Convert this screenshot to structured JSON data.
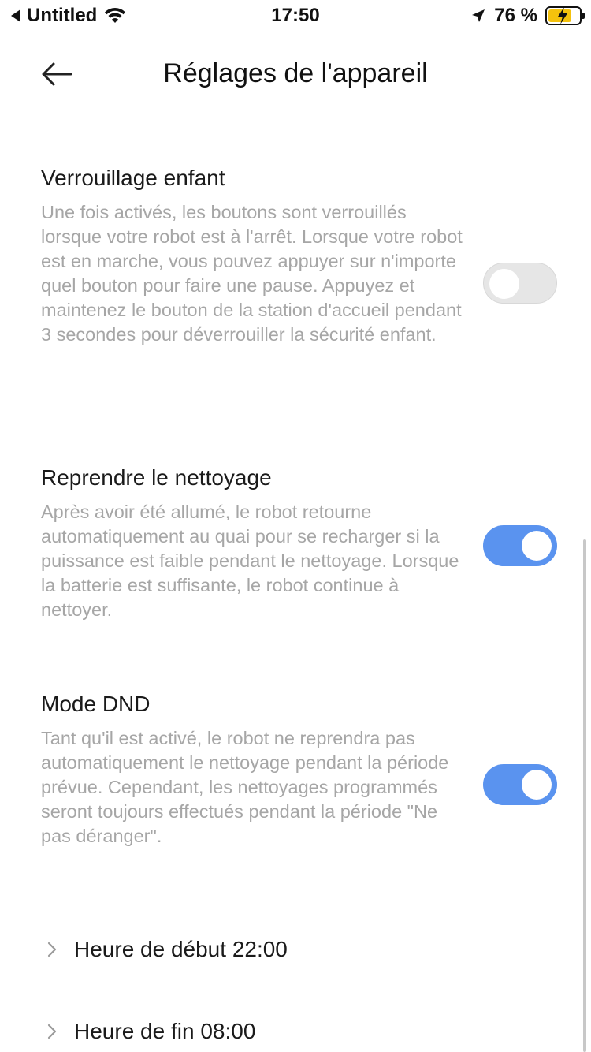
{
  "status_bar": {
    "back_app": "Untitled",
    "time": "17:50",
    "battery_percent": "76 %",
    "battery_level": 0.76
  },
  "header": {
    "title": "Réglages de l'appareil"
  },
  "settings": {
    "child_lock": {
      "title": "Verrouillage enfant",
      "description": "Une fois activés, les boutons sont verrouillés lorsque votre robot est à l'arrêt. Lorsque votre robot est en marche, vous pouvez appuyer sur n'importe quel bouton pour faire une pause. Appuyez et maintenez le bouton de la station d'accueil pendant 3 secondes pour déverrouiller la sécurité enfant.",
      "enabled": false
    },
    "resume_cleaning": {
      "title": "Reprendre le nettoyage",
      "description": "Après avoir été allumé, le robot retourne automatiquement au quai pour se recharger si la puissance est faible pendant le nettoyage. Lorsque la batterie est suffisante, le robot continue à nettoyer.",
      "enabled": true
    },
    "dnd_mode": {
      "title": "Mode DND",
      "description": "Tant qu'il est activé, le robot ne reprendra pas automatiquement le nettoyage pendant la période prévue. Cependant, les nettoyages programmés seront toujours effectués pendant la période \"Ne pas déranger\".",
      "enabled": true
    },
    "dnd_start": {
      "label": "Heure de début 22:00"
    },
    "dnd_end": {
      "label": "Heure de fin 08:00"
    }
  },
  "colors": {
    "toggle_on": "#5a93ef",
    "toggle_off": "#e6e6e6",
    "description_text": "#a6a6a6"
  }
}
